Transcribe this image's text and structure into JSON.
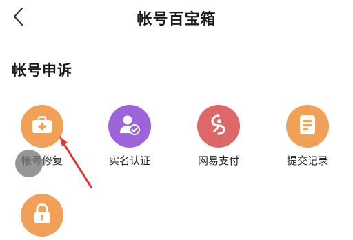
{
  "header": {
    "back_icon": "chevron-left-icon",
    "title": "帐号百宝箱"
  },
  "section": {
    "title": "帐号申诉"
  },
  "items": [
    {
      "label": "帐号修复",
      "icon": "medkit-icon",
      "color": "#F0A057"
    },
    {
      "label": "实名认证",
      "icon": "user-verified-icon",
      "color": "#9B65D9"
    },
    {
      "label": "网易支付",
      "icon": "netease-pay-icon",
      "color": "#DE6768"
    },
    {
      "label": "提交记录",
      "icon": "document-icon",
      "color": "#F0A057"
    },
    {
      "label": "",
      "icon": "lock-icon",
      "color": "#F0A057"
    }
  ],
  "colors": {
    "annotation_arrow": "#E8322E",
    "touch_indicator": "#777777"
  }
}
